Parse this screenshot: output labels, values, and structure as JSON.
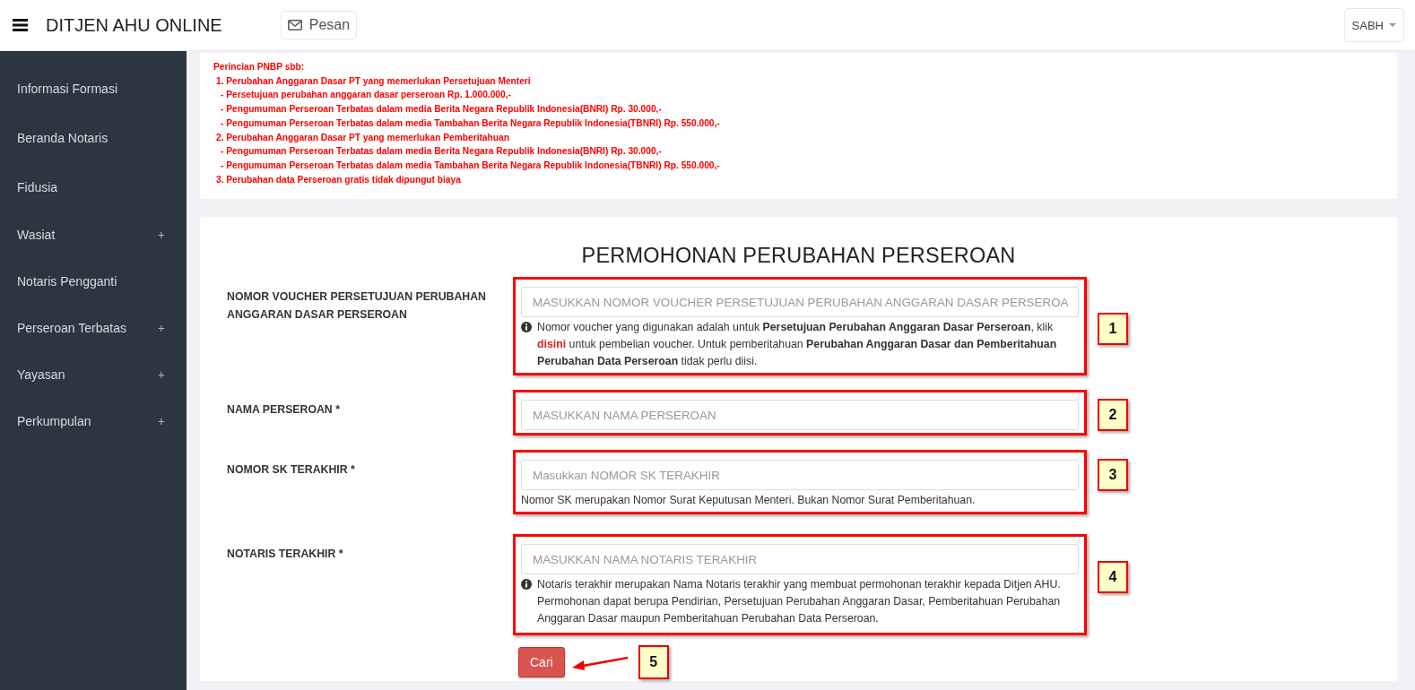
{
  "header": {
    "title": "DITJEN AHU ONLINE",
    "message_button": "Pesan",
    "user_menu": "SABH"
  },
  "sidebar": {
    "items": [
      {
        "label": "Informasi Formasi"
      },
      {
        "label": "Beranda Notaris"
      },
      {
        "label": "Fidusia"
      },
      {
        "label": "Wasiat",
        "toggle": "+"
      },
      {
        "label": "Notaris Pengganti"
      },
      {
        "label": "Perseroan Terbatas",
        "toggle": "+"
      },
      {
        "label": "Yayasan",
        "toggle": "+"
      },
      {
        "label": "Perkumpulan",
        "toggle": "+"
      }
    ]
  },
  "pnbp": {
    "title": "Perincian PNBP sbb:",
    "items": [
      {
        "text": "1. Perubahan Anggaran Dasar PT yang memerlukan Persetujuan Menteri",
        "children": [
          {
            "text": "- Persetujuan perubahan anggaran dasar perseroan Rp. 1.000.000,-"
          },
          {
            "text": "- Pengumuman Perseroan Terbatas dalam media Berita Negara Republik Indonesia(BNRI) Rp. 30.000,-"
          },
          {
            "text": "- Pengumuman Perseroan Terbatas dalam media Tambahan Berita Negara Republik Indonesia(TBNRI) Rp. 550.000,-"
          }
        ]
      },
      {
        "text": "2. Perubahan Anggaran Dasar PT yang memerlukan Pemberitahuan",
        "children": [
          {
            "text": "- Pengumuman Perseroan Terbatas dalam media Berita Negara Republik Indonesia(BNRI) Rp. 30.000,-"
          },
          {
            "text": "- Pengumuman Perseroan Terbatas dalam media Tambahan Berita Negara Republik Indonesia(TBNRI) Rp. 550.000,-"
          }
        ]
      },
      {
        "text": "3. Perubahan data Perseroan gratis tidak dipungut biaya"
      }
    ]
  },
  "form": {
    "title": "PERMOHONAN PERUBAHAN PERSEROAN",
    "fields": [
      {
        "label": "NOMOR VOUCHER PERSETUJUAN PERUBAHAN ANGGARAN DASAR PERSEROAN",
        "placeholder": "MASUKKAN NOMOR VOUCHER PERSETUJUAN PERUBAHAN ANGGARAN DASAR PERSEROA",
        "info_icon": true,
        "help": {
          "before": "Nomor voucher yang digunakan adalah untuk **Persetujuan Perubahan Anggaran Dasar Perseroan**, klik",
          "link": "disini",
          "after": "untuk pembelian voucher. Untuk pemberitahuan **Perubahan Anggaran Dasar dan Pemberitahuan Perubahan Data Perseroan** tidak perlu diisi."
        },
        "callout": "1"
      },
      {
        "label": "NAMA PERSEROAN *",
        "placeholder": "MASUKKAN NAMA PERSEROAN",
        "callout": "2"
      },
      {
        "label": "NOMOR SK TERAKHIR *",
        "placeholder": "Masukkan NOMOR SK TERAKHIR",
        "info_icon": false,
        "help": {
          "before": "Nomor SK merupakan Nomor Surat Keputusan Menteri. Bukan Nomor Surat Pemberitahuan."
        },
        "callout": "3"
      },
      {
        "label": "NOTARIS TERAKHIR *",
        "placeholder": "MASUKKAN NAMA NOTARIS TERAKHIR",
        "info_icon": true,
        "help": {
          "before": "Notaris terakhir merupakan Nama Notaris terakhir yang membuat permohonan terakhir kepada Ditjen AHU. Permohonan dapat berupa Pendirian, Persetujuan Perubahan Anggaran Dasar, Pemberitahuan Perubahan Anggaran Dasar maupun Pemberitahuan Perubahan Data Perseroan."
        },
        "callout": "4"
      }
    ],
    "submit": "Cari",
    "submit_callout": "5"
  }
}
